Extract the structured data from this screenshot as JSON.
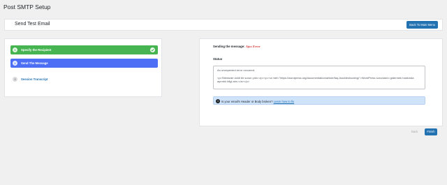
{
  "page": {
    "title": "Post SMTP Setup"
  },
  "header": {
    "title": "Send Test Email",
    "back_button": "Back To Main Menu"
  },
  "steps": [
    {
      "number": "1",
      "label": "Specify the Recipient",
      "state": "completed",
      "color": "#46b450"
    },
    {
      "number": "2",
      "label": "Send The Message",
      "state": "active",
      "color": "#4c6ff5"
    },
    {
      "number": "3",
      "label": "Session Transcript",
      "state": "pending"
    }
  ],
  "content": {
    "sending_label": "Sending the message:",
    "sending_status": "Ajax Error",
    "status_label": "Status",
    "status_line1": "An unexpected error occurred.",
    "status_line2": "<p>Sitenizde ciddi bir sorun çıktı.</p><p><a href=\"https://wordpress.org/documentation/article/faq-troubleshooting/\">WordPress sorunlarını gidermek hakkında ayrıntılı bilgi alın.</a></p>",
    "notice_text": "Is your email's Header or Body broken?",
    "notice_link": "Learn how to fix"
  },
  "footer": {
    "back_label": "Back",
    "finish_label": "Finish"
  },
  "colors": {
    "accent": "#2271b1",
    "success": "#46b450",
    "active": "#4c6ff5",
    "error": "#d63638",
    "notice_bg": "#cfe3fb"
  }
}
